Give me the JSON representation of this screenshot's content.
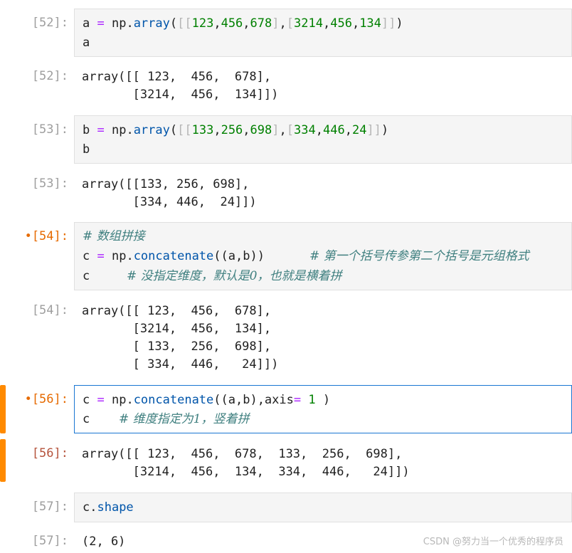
{
  "cells": [
    {
      "prompt_in": "[52]:",
      "input_lines": [
        "a = np.array([[123,456,678],[3214,456,134]])",
        "a"
      ],
      "prompt_out": "[52]:",
      "output_lines": [
        "array([[ 123,  456,  678],",
        "       [3214,  456,  134]])"
      ]
    },
    {
      "prompt_in": "[53]:",
      "input_lines": [
        "b = np.array([[133,256,698],[334,446,24]])",
        "b"
      ],
      "prompt_out": "[53]:",
      "output_lines": [
        "array([[133, 256, 698],",
        "       [334, 446,  24]])"
      ]
    },
    {
      "prompt_in": "•[54]:",
      "comment_line1": "# 数组拼接",
      "code_line2": "c = np.concatenate((a,b))",
      "comment_line2": "# 第一个括号传参第二个括号是元组格式",
      "code_line3": "c",
      "comment_line3": "# 没指定维度，默认是0，也就是横着拼",
      "prompt_out": "[54]:",
      "output_lines": [
        "array([[ 123,  456,  678],",
        "       [3214,  456,  134],",
        "       [ 133,  256,  698],",
        "       [ 334,  446,   24]])"
      ]
    },
    {
      "prompt_in": "•[56]:",
      "code_line1": "c = np.concatenate((a,b),axis= 1 )",
      "code_line2": "c",
      "comment_line2": "# 维度指定为1，竖着拼",
      "prompt_out": "[56]:",
      "output_lines": [
        "array([[ 123,  456,  678,  133,  256,  698],",
        "       [3214,  456,  134,  334,  446,   24]])"
      ]
    },
    {
      "prompt_in": "[57]:",
      "input_lines": [
        "c.shape"
      ],
      "prompt_out": "[57]:",
      "output_lines": [
        "(2, 6)"
      ]
    }
  ],
  "watermark": "CSDN @努力当一个优秀的程序员"
}
